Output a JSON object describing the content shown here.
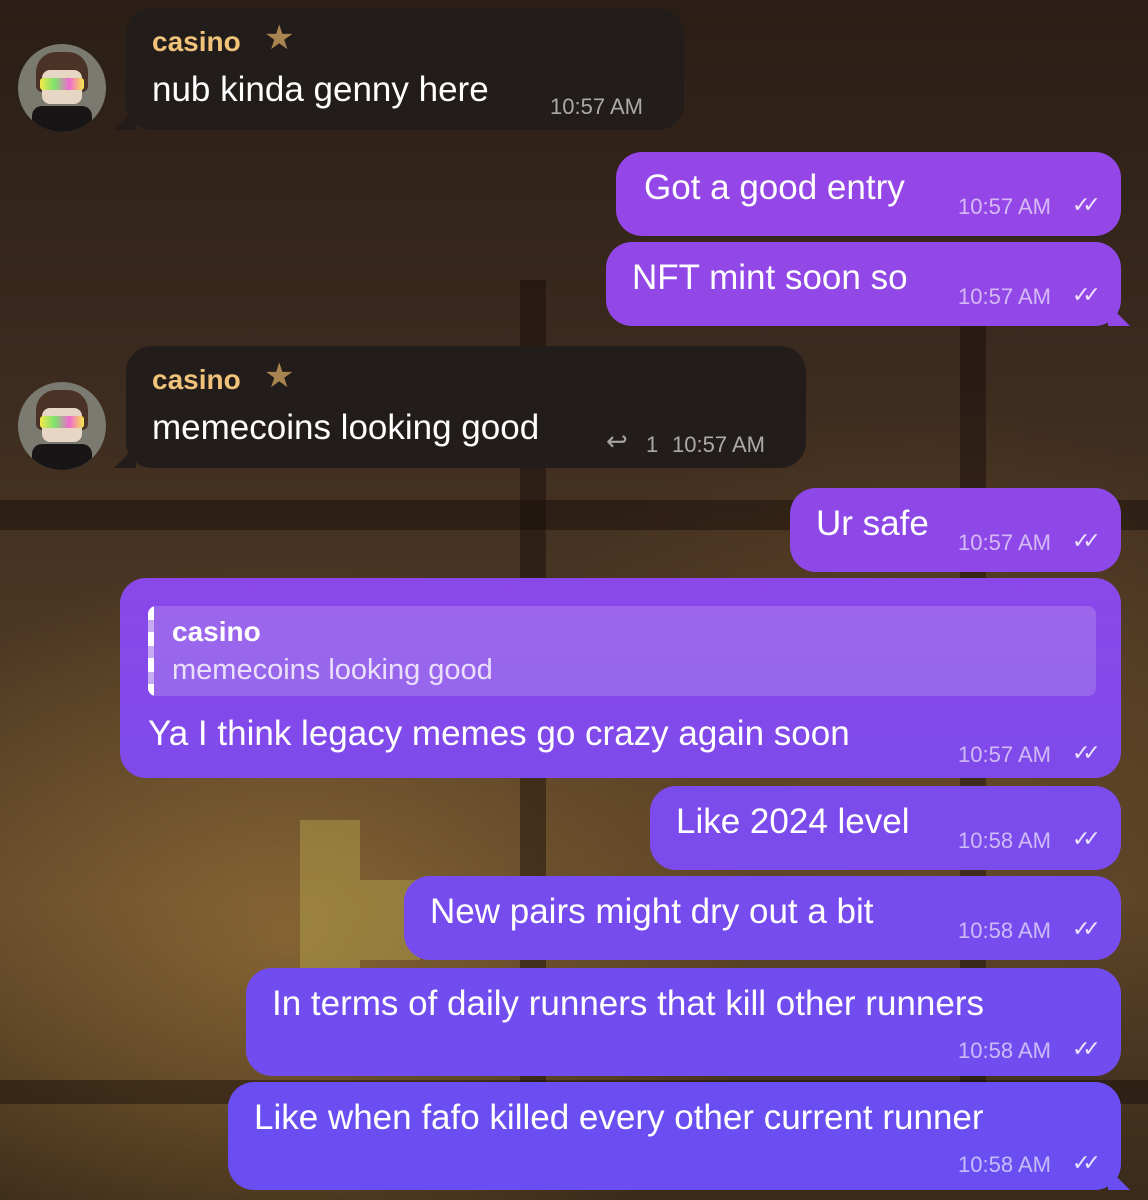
{
  "incoming": [
    {
      "sender": "casino",
      "text": "nub kinda genny here",
      "time": "10:57 AM",
      "reply_count": ""
    },
    {
      "sender": "casino",
      "text": "memecoins looking good",
      "time": "10:57 AM",
      "reply_count": "1"
    }
  ],
  "outgoing": [
    {
      "text": "Got a good entry",
      "time": "10:57 AM"
    },
    {
      "text": "NFT mint soon so",
      "time": "10:57 AM"
    },
    {
      "text": "Ur safe",
      "time": "10:57 AM"
    },
    {
      "text": "Ya I think legacy memes go crazy again soon",
      "time": "10:57 AM",
      "quote_sender": "casino",
      "quote_text": "memecoins looking good"
    },
    {
      "text": "Like 2024 level",
      "time": "10:58 AM"
    },
    {
      "text": "New pairs might dry out a bit",
      "time": "10:58 AM"
    },
    {
      "text": "In terms of daily runners that kill other runners",
      "time": "10:58 AM"
    },
    {
      "text": "Like when fafo killed every other current runner",
      "time": "10:58 AM"
    }
  ],
  "icons": {
    "read_checks": "double-check-icon",
    "admin_star": "star-icon",
    "reply": "reply-arrow-icon"
  },
  "colors": {
    "sender_name": "#f0c27a",
    "incoming_bubble": "#221d1b",
    "outgoing_bubble_top": "#9747e6",
    "outgoing_bubble_bottom": "#6a4ef2"
  }
}
